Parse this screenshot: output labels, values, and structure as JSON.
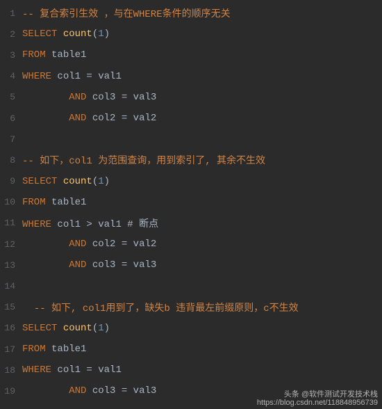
{
  "lines": [
    {
      "num": "1",
      "tokens": [
        {
          "t": "-- 复合索引生效 ，与在WHERE条件的顺序无关",
          "c": "t-comment"
        }
      ]
    },
    {
      "num": "2",
      "tokens": [
        {
          "t": "SELECT",
          "c": "t-keyword"
        },
        {
          "t": " "
        },
        {
          "t": "count",
          "c": "t-func"
        },
        {
          "t": "(",
          "c": "t-paren"
        },
        {
          "t": "1",
          "c": "t-num"
        },
        {
          "t": ")",
          "c": "t-paren"
        }
      ]
    },
    {
      "num": "3",
      "tokens": [
        {
          "t": "FROM",
          "c": "t-keyword"
        },
        {
          "t": " "
        },
        {
          "t": "table1",
          "c": "t-ident"
        }
      ]
    },
    {
      "num": "4",
      "tokens": [
        {
          "t": "WHERE",
          "c": "t-keyword"
        },
        {
          "t": " "
        },
        {
          "t": "col1",
          "c": "t-ident"
        },
        {
          "t": " = ",
          "c": "t-op"
        },
        {
          "t": "val1",
          "c": "t-ident"
        }
      ]
    },
    {
      "num": "5",
      "tokens": [
        {
          "t": "        "
        },
        {
          "t": "AND",
          "c": "t-keyword"
        },
        {
          "t": " "
        },
        {
          "t": "col3",
          "c": "t-ident"
        },
        {
          "t": " = ",
          "c": "t-op"
        },
        {
          "t": "val3",
          "c": "t-ident"
        }
      ]
    },
    {
      "num": "6",
      "tokens": [
        {
          "t": "        "
        },
        {
          "t": "AND",
          "c": "t-keyword"
        },
        {
          "t": " "
        },
        {
          "t": "col2",
          "c": "t-ident"
        },
        {
          "t": " = ",
          "c": "t-op"
        },
        {
          "t": "val2",
          "c": "t-ident"
        }
      ]
    },
    {
      "num": "7",
      "tokens": []
    },
    {
      "num": "8",
      "tokens": [
        {
          "t": "-- 如下，col1 为范围查询，用到索引了, 其余不生效",
          "c": "t-comment"
        }
      ]
    },
    {
      "num": "9",
      "tokens": [
        {
          "t": "SELECT",
          "c": "t-keyword"
        },
        {
          "t": " "
        },
        {
          "t": "count",
          "c": "t-func"
        },
        {
          "t": "(",
          "c": "t-paren"
        },
        {
          "t": "1",
          "c": "t-num"
        },
        {
          "t": ")",
          "c": "t-paren"
        }
      ]
    },
    {
      "num": "10",
      "tokens": [
        {
          "t": "FROM",
          "c": "t-keyword"
        },
        {
          "t": " "
        },
        {
          "t": "table1",
          "c": "t-ident"
        }
      ]
    },
    {
      "num": "11",
      "tokens": [
        {
          "t": "WHERE",
          "c": "t-keyword"
        },
        {
          "t": " "
        },
        {
          "t": "col1",
          "c": "t-ident"
        },
        {
          "t": " > ",
          "c": "t-op"
        },
        {
          "t": "val1",
          "c": "t-ident"
        },
        {
          "t": " "
        },
        {
          "t": "# 断点",
          "c": "t-hash"
        }
      ]
    },
    {
      "num": "12",
      "tokens": [
        {
          "t": "        "
        },
        {
          "t": "AND",
          "c": "t-keyword"
        },
        {
          "t": " "
        },
        {
          "t": "col2",
          "c": "t-ident"
        },
        {
          "t": " = ",
          "c": "t-op"
        },
        {
          "t": "val2",
          "c": "t-ident"
        }
      ]
    },
    {
      "num": "13",
      "tokens": [
        {
          "t": "        "
        },
        {
          "t": "AND",
          "c": "t-keyword"
        },
        {
          "t": " "
        },
        {
          "t": "col3",
          "c": "t-ident"
        },
        {
          "t": " = ",
          "c": "t-op"
        },
        {
          "t": "val3",
          "c": "t-ident"
        }
      ]
    },
    {
      "num": "14",
      "tokens": []
    },
    {
      "num": "15",
      "tokens": [
        {
          "t": "  "
        },
        {
          "t": "-- 如下, col1用到了，缺失b 违背最左前缀原则，c不生效",
          "c": "t-comment"
        }
      ]
    },
    {
      "num": "16",
      "tokens": [
        {
          "t": "SELECT",
          "c": "t-keyword"
        },
        {
          "t": " "
        },
        {
          "t": "count",
          "c": "t-func"
        },
        {
          "t": "(",
          "c": "t-paren"
        },
        {
          "t": "1",
          "c": "t-num"
        },
        {
          "t": ")",
          "c": "t-paren"
        }
      ]
    },
    {
      "num": "17",
      "tokens": [
        {
          "t": "FROM",
          "c": "t-keyword"
        },
        {
          "t": " "
        },
        {
          "t": "table1",
          "c": "t-ident"
        }
      ]
    },
    {
      "num": "18",
      "tokens": [
        {
          "t": "WHERE",
          "c": "t-keyword"
        },
        {
          "t": " "
        },
        {
          "t": "col1",
          "c": "t-ident"
        },
        {
          "t": " = ",
          "c": "t-op"
        },
        {
          "t": "val1",
          "c": "t-ident"
        }
      ]
    },
    {
      "num": "19",
      "tokens": [
        {
          "t": "        "
        },
        {
          "t": "AND",
          "c": "t-keyword"
        },
        {
          "t": " "
        },
        {
          "t": "col3",
          "c": "t-ident"
        },
        {
          "t": " = ",
          "c": "t-op"
        },
        {
          "t": "val3",
          "c": "t-ident"
        }
      ]
    }
  ],
  "watermark": {
    "line1": "头条 @软件测试开发技术栈",
    "line2": "https://blog.csdn.net/118848956739"
  }
}
